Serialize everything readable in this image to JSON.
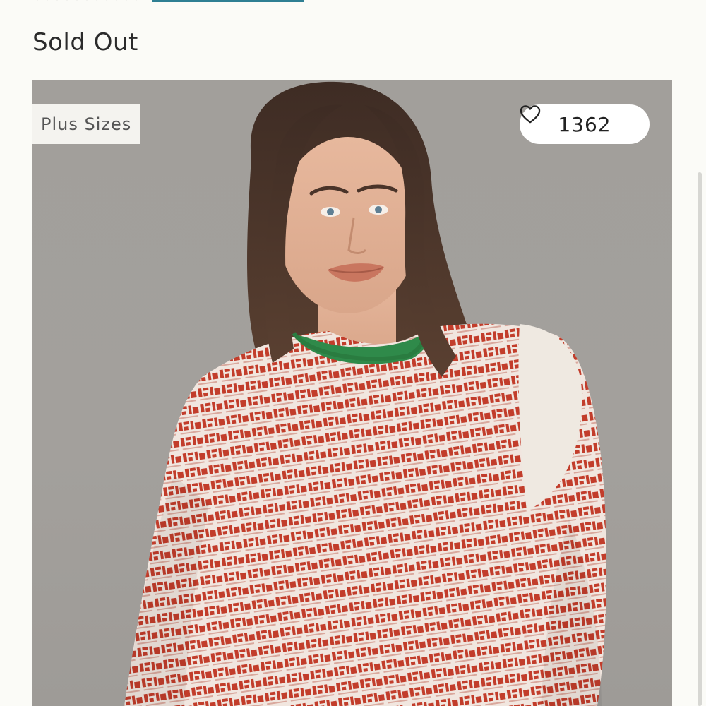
{
  "product": {
    "availability": "Sold Out",
    "badge": "Plus Sizes",
    "likes_count": "1362"
  },
  "icons": {
    "like": "heart-outline-icon"
  },
  "colors": {
    "accent_link": "#2f7f93",
    "background": "#fbfbf7",
    "badge_bg": "#f4f3ef",
    "likes_pill_bg": "#ffffff"
  },
  "image": {
    "subject": "model wearing red and cream holiday word-pattern sweater with green collar"
  }
}
